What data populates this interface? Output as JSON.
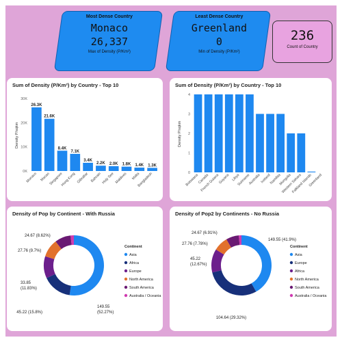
{
  "kpis": {
    "most_dense": {
      "title": "Most Dense Country",
      "country": "Monaco",
      "value": "26,337",
      "caption": "Max of Density (P/Km²)"
    },
    "least_dense": {
      "title": "Least Dense Country",
      "country": "Greenland",
      "value": "0",
      "caption": "Min of Density (P/Km²)"
    },
    "count": {
      "value": "236",
      "caption": "Count of Country"
    }
  },
  "colors": {
    "bar": "#1e88f0",
    "page_bg": "#dfa5d8",
    "kpi": "#1e8bf0",
    "kpi_count": "#e8a3e0"
  },
  "chart_data": [
    {
      "type": "bar",
      "title": "Sum of Density (P/Km²) by Country - Top 10",
      "ylabel": "Density P/sqkm",
      "categories": [
        "Monaco",
        "Macao",
        "Singapore",
        "Hong Kong",
        "Gibraltar",
        "Bahrain",
        "Holy See",
        "Maldives",
        "Malta",
        "Bangladesh"
      ],
      "values": [
        26337,
        21600,
        8400,
        7100,
        3400,
        2200,
        2000,
        1800,
        1400,
        1300
      ],
      "data_labels": [
        "26.3K",
        "21.6K",
        "8.4K",
        "7.1K",
        "3.4K",
        "2.2K",
        "2.0K",
        "1.8K",
        "1.4K",
        "1.3K"
      ],
      "ylim": [
        0,
        30000
      ],
      "yticks": [
        0,
        10000,
        20000,
        30000
      ],
      "ytick_labels": [
        "0K",
        "10K",
        "20K",
        "30K"
      ]
    },
    {
      "type": "bar",
      "title": "Sum of Density (P/Km²) by Country - Top 10",
      "ylabel": "Density P/sqkm",
      "categories": [
        "Botswana",
        "Canada",
        "French Guiana",
        "Guyana",
        "Libya",
        "Suriname",
        "Australia",
        "Iceland",
        "Namibia",
        "Mongolia",
        "Western Sahara",
        "Falkland Islands",
        "Greenland"
      ],
      "values": [
        4,
        4,
        4,
        4,
        4,
        4,
        3,
        3,
        3,
        2,
        2,
        0.04,
        0
      ],
      "ylim": [
        0,
        4
      ],
      "yticks": [
        0,
        1,
        2,
        3,
        4
      ],
      "ytick_labels": [
        "0",
        "1",
        "2",
        "3",
        "4"
      ]
    },
    {
      "type": "pie",
      "donut": true,
      "title": "Density of Pop by Continent - With Russia",
      "legend_title": "Continent",
      "legend_position": "right",
      "slices": [
        {
          "label": "Asia",
          "value": 149.55,
          "display": "149.55\n(52.27%)",
          "color": "#1e88f0"
        },
        {
          "label": "Africa",
          "value": 45.22,
          "display": "45.22 (15.8%)",
          "color": "#17307a"
        },
        {
          "label": "Europe",
          "value": 33.85,
          "display": "33.85\n(11.83%)",
          "color": "#6c1f8c"
        },
        {
          "label": "North America",
          "value": 27.76,
          "display": "27.76 (9.7%)",
          "color": "#e2712c"
        },
        {
          "label": "South America",
          "value": 24.67,
          "display": "24.67 (8.62%)",
          "color": "#6a1a73"
        },
        {
          "label": "Australia / Oceania",
          "value": 4.99,
          "display": "",
          "color": "#d03ab0"
        }
      ]
    },
    {
      "type": "pie",
      "donut": true,
      "title": "Density of Pop2 by Continents - No Russia",
      "legend_title": "Continent",
      "legend_position": "right",
      "slices": [
        {
          "label": "Asia",
          "value": 149.55,
          "display": "149.55 (41.9%)",
          "color": "#1e88f0"
        },
        {
          "label": "Europe",
          "value": 104.64,
          "display": "104.64 (29.32%)",
          "color": "#17307a"
        },
        {
          "label": "Africa",
          "value": 45.22,
          "display": "45.22\n(12.67%)",
          "color": "#6c1f8c"
        },
        {
          "label": "North America",
          "value": 27.76,
          "display": "27.76 (7.78%)",
          "color": "#e2712c"
        },
        {
          "label": "South America",
          "value": 24.67,
          "display": "24.67 (6.91%)",
          "color": "#6a1a73"
        },
        {
          "label": "Australia / Oceania",
          "value": 5.08,
          "display": "",
          "color": "#d03ab0"
        }
      ]
    }
  ]
}
